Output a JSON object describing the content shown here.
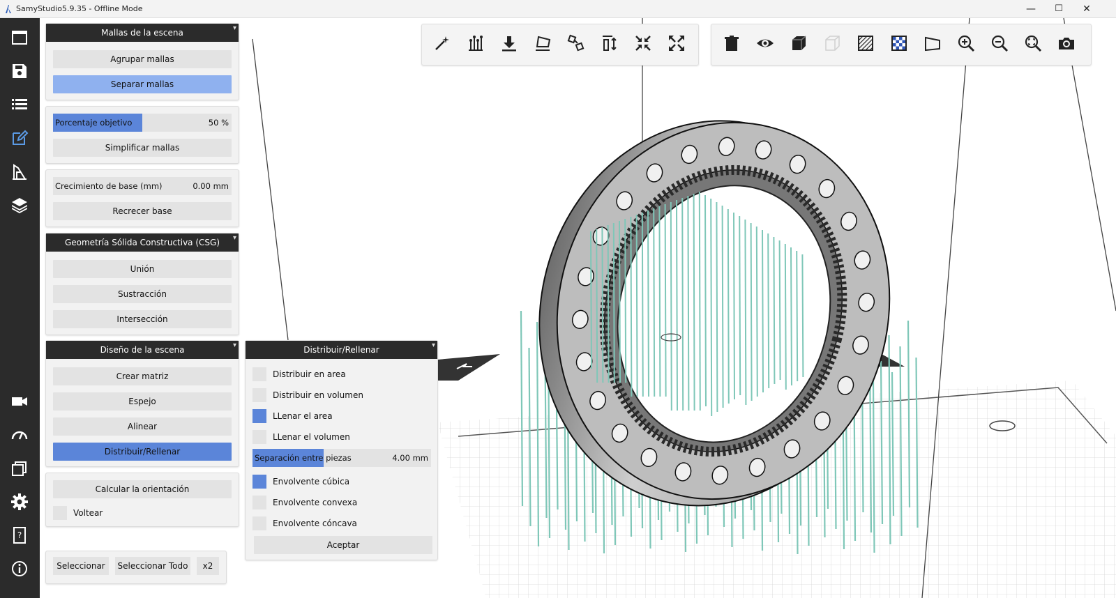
{
  "window": {
    "title": "SamyStudio5.9.35 - Offline Mode",
    "controls": {
      "minimize": "—",
      "maximize": "☐",
      "close": "✕"
    }
  },
  "sidebar": {
    "icons": [
      "window-icon",
      "save-icon",
      "list-icon",
      "edit-icon",
      "print-icon",
      "layers-icon",
      "camera-icon",
      "gauge-icon",
      "windows-icon",
      "gear-icon",
      "help-book-icon",
      "info-icon"
    ],
    "active": "edit-icon",
    "active_color": "#5b9be6"
  },
  "panels": {
    "scene_meshes": {
      "title": "Mallas de la escena",
      "group_label": "Agrupar mallas",
      "separate_label": "Separar mallas"
    },
    "simplify": {
      "slider_label": "Porcentaje objetivo",
      "slider_value": "50 %",
      "slider_fraction": 0.5,
      "button_label": "Simplificar mallas"
    },
    "base": {
      "slider_label": "Crecimiento de base (mm)",
      "slider_value": "0.00 mm",
      "button_label": "Recrecer base"
    },
    "csg": {
      "title": "Geometría Sólida Constructiva (CSG)",
      "union_label": "Unión",
      "subtraction_label": "Sustracción",
      "intersection_label": "Intersección"
    },
    "scene_design": {
      "title": "Diseño de la escena",
      "matrix_label": "Crear matriz",
      "mirror_label": "Espejo",
      "align_label": "Alinear",
      "distribute_label": "Distribuir/Rellenar"
    },
    "orientation": {
      "calc_label": "Calcular la orientación",
      "flip_label": "Voltear"
    },
    "distribute": {
      "title": "Distribuir/Rellenar",
      "options": [
        {
          "label": "Distribuir en area",
          "checked": false
        },
        {
          "label": "Distribuir en volumen",
          "checked": false
        },
        {
          "label": "LLenar el area",
          "checked": true
        },
        {
          "label": "LLenar el volumen",
          "checked": false
        }
      ],
      "spacing_label": "Separación entre piezas",
      "spacing_value": "4.00 mm",
      "envelopes": [
        {
          "label": "Envolvente cúbica",
          "checked": true
        },
        {
          "label": "Envolvente convexa",
          "checked": false
        },
        {
          "label": "Envolvente cóncava",
          "checked": false
        }
      ],
      "accept_label": "Aceptar"
    }
  },
  "selection_bar": {
    "select_label": "Seleccionar",
    "select_all_label": "Seleccionar Todo",
    "x2_label": "x2"
  },
  "toolbar_left": [
    "magic-wand-icon",
    "supports-icon",
    "drop-to-bed-icon",
    "lay-flat-icon",
    "rotate-icon",
    "scale-icon",
    "shrink-icon",
    "expand-icon"
  ],
  "toolbar_right": [
    "trash-icon",
    "eye-icon",
    "solid-cube-icon",
    "ghost-cube-icon",
    "hatch-icon",
    "checker-icon",
    "plane-icon",
    "zoom-in-icon",
    "zoom-out-icon",
    "zoom-fit-icon",
    "camera-snapshot-icon"
  ],
  "colors": {
    "accent": "#5b85d9",
    "accent_light": "#8fb1ef",
    "sidebar_bg": "#2b2b2b",
    "support_color": "#7fc7b8"
  }
}
